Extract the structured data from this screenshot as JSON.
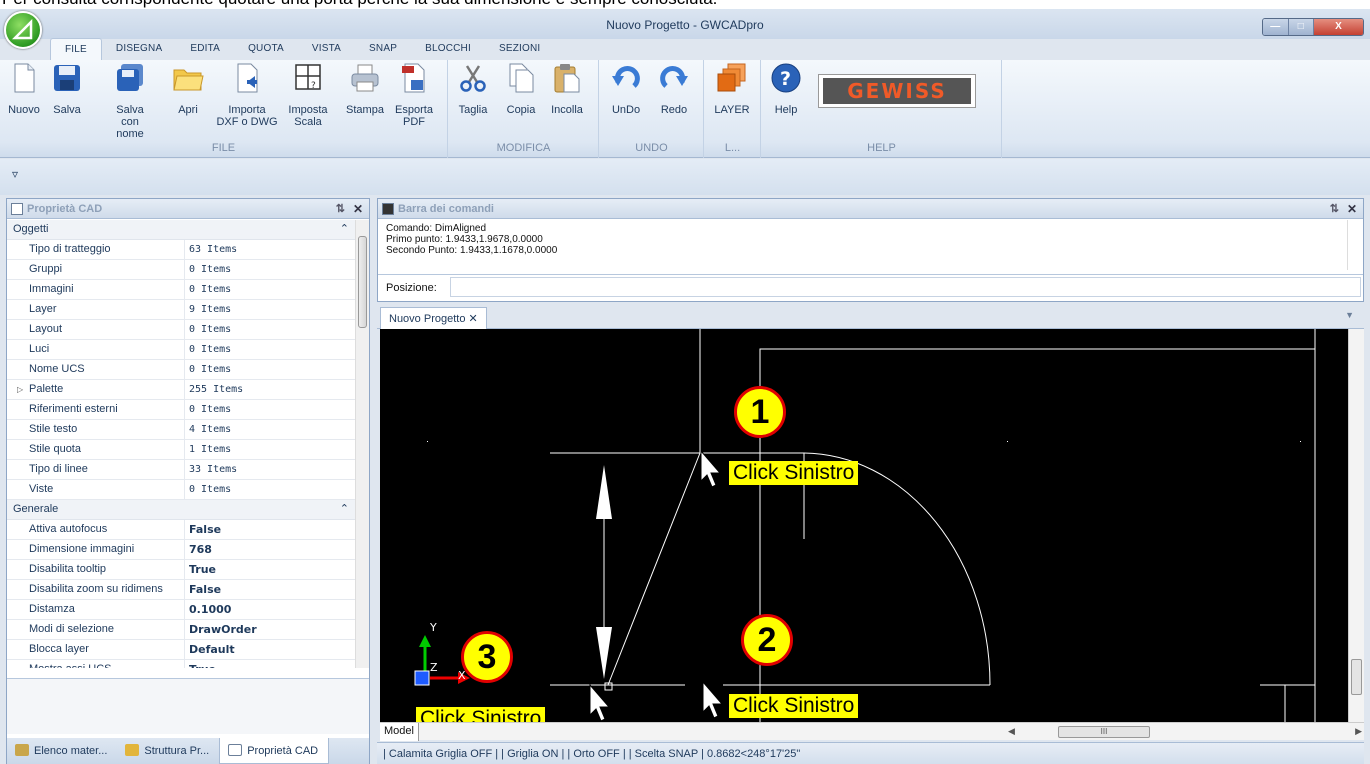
{
  "header_clip": "Per consulta corrispondente quotare una porta perché la sua dimensione è sempre conosciuta.",
  "window": {
    "title": "Nuovo Progetto - GWCADpro"
  },
  "tabs": [
    "FILE",
    "DISEGNA",
    "EDITA",
    "QUOTA",
    "VISTA",
    "SNAP",
    "BLOCCHI",
    "SEZIONI"
  ],
  "ribbon": {
    "file": {
      "label": "FILE",
      "nuovo": "Nuovo",
      "salva": "Salva",
      "salva_nome": "Salva\ncon nome",
      "apri": "Apri",
      "importa": "Importa\nDXF o DWG",
      "imposta": "Imposta\nScala",
      "stampa": "Stampa",
      "esporta": "Esporta\nPDF"
    },
    "modifica": {
      "label": "MODIFICA",
      "taglia": "Taglia",
      "copia": "Copia",
      "incolla": "Incolla"
    },
    "undo": {
      "label": "UNDO",
      "undo": "UnDo",
      "redo": "Redo"
    },
    "layer": {
      "label": "L...",
      "layer": "LAYER"
    },
    "help": {
      "label": "HELP",
      "help": "Help",
      "logo": "GEWISS"
    }
  },
  "qat": {
    "dropdown": "▿"
  },
  "props": {
    "title": "Proprietà CAD",
    "cat1": "Oggetti",
    "rows1": [
      {
        "k": "Tipo di tratteggio",
        "v": "63 Items"
      },
      {
        "k": "Gruppi",
        "v": "0 Items"
      },
      {
        "k": "Immagini",
        "v": "0 Items"
      },
      {
        "k": "Layer",
        "v": "9 Items"
      },
      {
        "k": "Layout",
        "v": "0 Items"
      },
      {
        "k": "Luci",
        "v": "0 Items"
      },
      {
        "k": "Nome UCS",
        "v": "0 Items"
      },
      {
        "k": "Palette",
        "v": "255 Items"
      },
      {
        "k": "Riferimenti esterni",
        "v": "0 Items"
      },
      {
        "k": "Stile testo",
        "v": "4 Items"
      },
      {
        "k": "Stile quota",
        "v": "1 Items"
      },
      {
        "k": "Tipo di linee",
        "v": "33 Items"
      },
      {
        "k": "Viste",
        "v": "0 Items"
      }
    ],
    "cat2": "Generale",
    "rows2": [
      {
        "k": "Attiva autofocus",
        "v": "False"
      },
      {
        "k": "Dimensione immagini",
        "v": "768"
      },
      {
        "k": "Disabilita tooltip",
        "v": "True"
      },
      {
        "k": "Disabilita zoom su ridimens",
        "v": "False"
      },
      {
        "k": "Distamza",
        "v": "0.1000"
      },
      {
        "k": "Modi di selezione",
        "v": "DrawOrder"
      },
      {
        "k": "Blocca layer",
        "v": "Default"
      },
      {
        "k": "Mostra assi UCS",
        "v": "True"
      }
    ]
  },
  "bottom_tabs": [
    "Elenco mater...",
    "Struttura Pr...",
    "Proprietà CAD"
  ],
  "cmd": {
    "title": "Barra dei comandi",
    "lines": [
      "Comando: DimAligned",
      "Primo punto: 1.9433,1.9678,0.0000",
      "Secondo Punto: 1.9433,1.1678,0.0000"
    ],
    "pos_label": "Posizione:"
  },
  "doc": {
    "tab": "Nuovo Progetto",
    "model_tab": "Model"
  },
  "status": "| Calamita Griglia OFF | | Griglia ON | | Orto OFF |  | Scelta SNAP |   0.8682<248°17'25\"",
  "annotations": {
    "n1": "1",
    "n2": "2",
    "n3": "3",
    "click": "Click Sinistro",
    "axis_x": "X",
    "axis_y": "Y",
    "axis_z": "Z"
  },
  "colors": {
    "badge_fill": "#ffff00",
    "badge_border": "#e00000",
    "canvas": "#000000"
  }
}
